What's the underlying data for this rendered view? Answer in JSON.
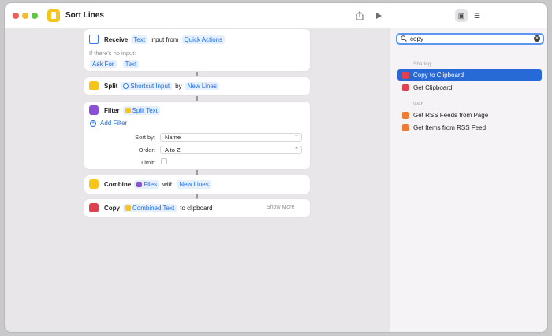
{
  "window": {
    "title": "Sort Lines"
  },
  "search": {
    "query": "copy"
  },
  "results": {
    "sharing_header": "Sharing",
    "sharing": [
      "Copy to Clipboard",
      "Get Clipboard"
    ],
    "web_header": "Web",
    "web": [
      "Get RSS Feeds from Page",
      "Get Items from RSS Feed"
    ]
  },
  "receive": {
    "label": "Receive",
    "type": "Text",
    "middle": "input from",
    "source": "Quick Actions",
    "no_input": "If there's no input:",
    "ask_for": "Ask For",
    "ask_type": "Text"
  },
  "split": {
    "label": "Split",
    "input": "Shortcut Input",
    "by": "by",
    "sep": "New Lines"
  },
  "filter": {
    "label": "Filter",
    "input": "Split Text",
    "add": "Add Filter",
    "sort_by_label": "Sort by:",
    "sort_by": "Name",
    "order_label": "Order:",
    "order": "A to Z",
    "limit_label": "Limit:"
  },
  "combine": {
    "label": "Combine",
    "input": "Files",
    "with": "with",
    "sep": "New Lines"
  },
  "copy": {
    "label": "Copy",
    "input": "Combined Text",
    "to": "to clipboard",
    "more": "Show More"
  },
  "colors": {
    "accent": "#2869d8",
    "token": "#1f6fe6",
    "yellow": "#f7c418",
    "purple": "#8a4fd6",
    "red": "#e0414f",
    "orange": "#ee7c32"
  }
}
